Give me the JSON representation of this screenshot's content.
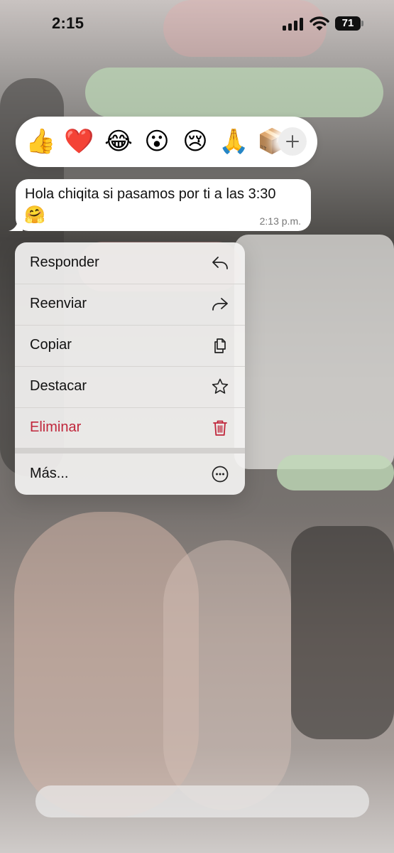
{
  "status_bar": {
    "time": "2:15",
    "battery_level": "71",
    "icons": [
      "cellular-signal-icon",
      "wifi-icon",
      "battery-icon"
    ]
  },
  "reactions": {
    "emojis": [
      {
        "name": "thumbs-up-emoji",
        "glyph": "👍"
      },
      {
        "name": "red-heart-emoji",
        "glyph": "❤️"
      },
      {
        "name": "tears-of-joy-emoji",
        "glyph": "😂"
      },
      {
        "name": "surprised-face-emoji",
        "glyph": "😮"
      },
      {
        "name": "crying-face-emoji",
        "glyph": "😢"
      },
      {
        "name": "folded-hands-emoji",
        "glyph": "🙏"
      },
      {
        "name": "package-emoji",
        "glyph": "📦"
      }
    ],
    "more_icon": "plus-icon"
  },
  "message": {
    "text": "Hola chiqita si pasamos por ti a las 3:30",
    "emoji": "🤗",
    "time": "2:13 p.m.",
    "bubble_color": "#ffffff"
  },
  "menu": {
    "items": [
      {
        "label": "Responder",
        "icon": "reply-icon"
      },
      {
        "label": "Reenviar",
        "icon": "forward-icon"
      },
      {
        "label": "Copiar",
        "icon": "copy-icon"
      },
      {
        "label": "Destacar",
        "icon": "star-icon"
      },
      {
        "label": "Eliminar",
        "icon": "trash-icon",
        "color": "#c0263b"
      }
    ],
    "more": {
      "label": "Más...",
      "icon": "ellipsis-circle-icon"
    }
  }
}
